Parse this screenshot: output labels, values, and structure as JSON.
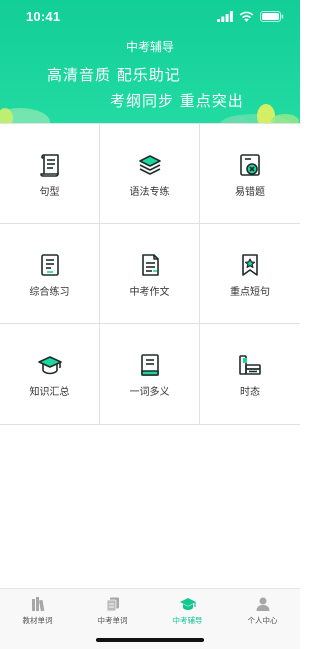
{
  "status_bar": {
    "time": "10:41"
  },
  "header": {
    "title": "中考辅导",
    "slogan_line1": "高清音质 配乐助记",
    "slogan_line2": "考纲同步 重点突出"
  },
  "grid": [
    {
      "label": "句型",
      "icon": "scroll-icon"
    },
    {
      "label": "语法专练",
      "icon": "layers-icon"
    },
    {
      "label": "易错题",
      "icon": "error-doc-icon"
    },
    {
      "label": "综合练习",
      "icon": "document-icon"
    },
    {
      "label": "中考作文",
      "icon": "paper-icon"
    },
    {
      "label": "重点短句",
      "icon": "bookmark-star-icon"
    },
    {
      "label": "知识汇总",
      "icon": "graduation-cap-icon"
    },
    {
      "label": "一词多义",
      "icon": "book-icon"
    },
    {
      "label": "时态",
      "icon": "books-stack-icon"
    }
  ],
  "tabbar": {
    "tabs": [
      {
        "label": "教材单词",
        "icon": "books-icon",
        "active": false
      },
      {
        "label": "中考单词",
        "icon": "cards-icon",
        "active": false
      },
      {
        "label": "中考辅导",
        "icon": "graduation-cap-icon",
        "active": true
      },
      {
        "label": "个人中心",
        "icon": "person-icon",
        "active": false
      }
    ]
  },
  "colors": {
    "brand_green": "#1ad59d",
    "active_tab": "#12c792",
    "icon_dark": "#1f2d2a",
    "icon_accent": "#1ed6a0"
  }
}
